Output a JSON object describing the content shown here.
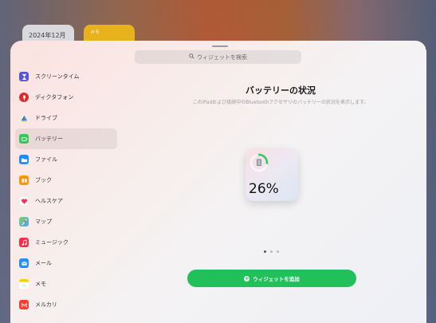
{
  "background": {
    "calendar_widget_text": "2024年12月",
    "memo_widget_text": "メモ"
  },
  "search": {
    "placeholder": "ウィジェットを検索",
    "icon": "search-icon"
  },
  "sidebar": {
    "items": [
      {
        "label": "スクリーンタイム",
        "icon": "hourglass-icon",
        "color": "#5856d6",
        "selected": false
      },
      {
        "label": "ディクタフォン",
        "icon": "microphone-icon",
        "color": "#e02a2a",
        "selected": false
      },
      {
        "label": "ドライブ",
        "icon": "drive-triangle-icon",
        "color": "#4285f4",
        "selected": false
      },
      {
        "label": "バッテリー",
        "icon": "battery-icon",
        "color": "#34c759",
        "selected": true
      },
      {
        "label": "ファイル",
        "icon": "folder-icon",
        "color": "#1a8cff",
        "selected": false
      },
      {
        "label": "ブック",
        "icon": "book-icon",
        "color": "#ff9500",
        "selected": false
      },
      {
        "label": "ヘルスケア",
        "icon": "heart-icon",
        "color": "#ff2d55",
        "selected": false
      },
      {
        "label": "マップ",
        "icon": "map-icon",
        "color": "#34c759",
        "selected": false
      },
      {
        "label": "ミュージック",
        "icon": "music-note-icon",
        "color": "#fa2d48",
        "selected": false
      },
      {
        "label": "メール",
        "icon": "mail-icon",
        "color": "#1e90ff",
        "selected": false
      },
      {
        "label": "メモ",
        "icon": "notes-icon",
        "color": "#ffcc00",
        "selected": false
      },
      {
        "label": "メルカリ",
        "icon": "mercari-icon",
        "color": "#ff3b30",
        "selected": false
      }
    ]
  },
  "main": {
    "title": "バッテリーの状況",
    "subtitle": "このiPadおよび接続中のBluetoothアクセサリのバッテリーの状況を表示します。",
    "widget": {
      "percent_text": "26%",
      "level": 0.26,
      "ring_color": "#34c759",
      "device_icon": "ipad-icon"
    },
    "pager": {
      "count": 3,
      "active": 0
    },
    "add_button_label": "ウィジェットを追加"
  },
  "colors": {
    "accent": "#22c05a"
  }
}
